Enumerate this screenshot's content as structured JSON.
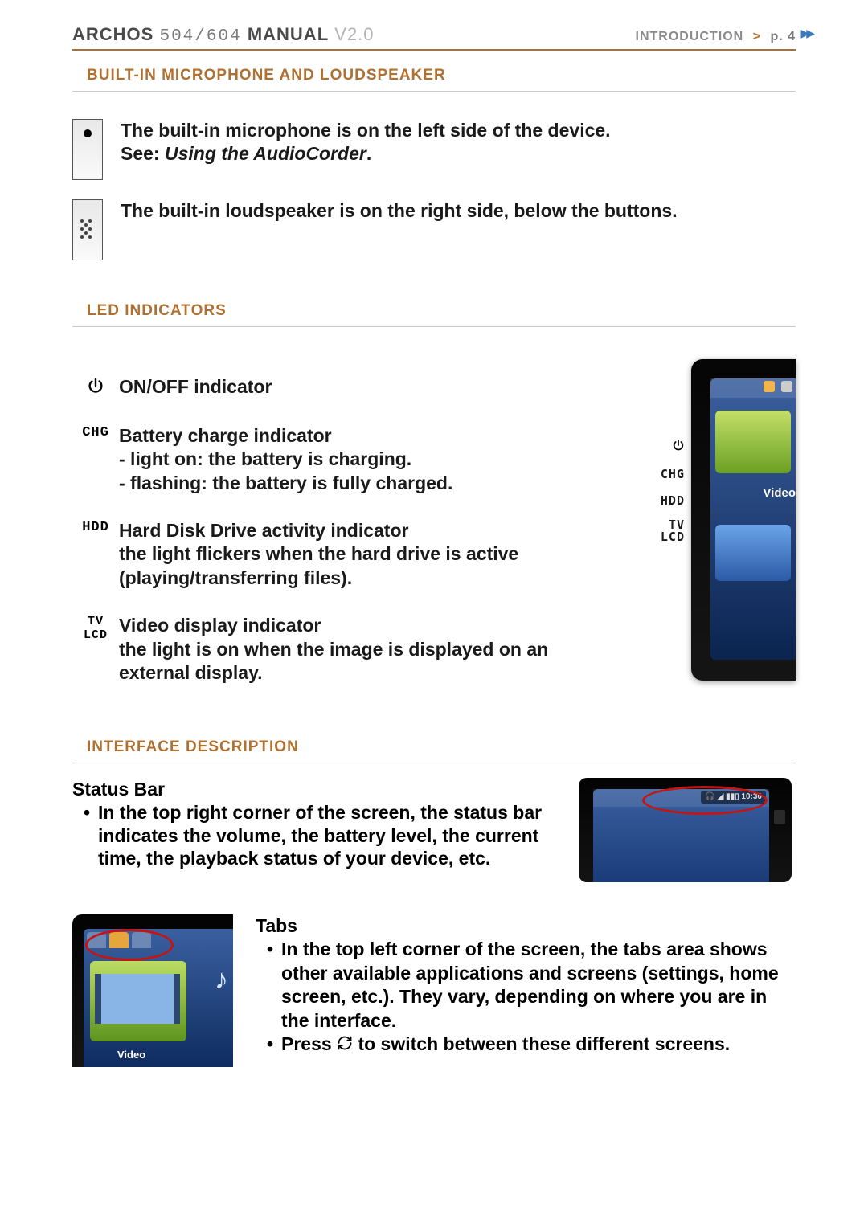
{
  "header": {
    "brand": "ARCHOS",
    "model": "504/604",
    "manual": "MANUAL",
    "version": "V2.0",
    "section": "INTRODUCTION",
    "page_label": "p. 4"
  },
  "sections": {
    "mic_speaker_title": "BUILT-IN MICROPHONE AND LOUDSPEAKER",
    "led_title": "LED INDICATORS",
    "interface_title": "INTERFACE DESCRIPTION"
  },
  "mic": {
    "line1": "The built-in microphone is on the left side of the device.",
    "line2_prefix": "See: ",
    "line2_ref": "Using the AudioCorder",
    "line2_suffix": "."
  },
  "speaker": {
    "line": "The built-in loudspeaker is on the right side, below the buttons."
  },
  "led": {
    "power": {
      "label": "⏻",
      "title": "ON/OFF indicator"
    },
    "chg": {
      "label": "CHG",
      "title": "Battery charge indicator",
      "l1": "- light on: the battery is charging.",
      "l2": "- flashing: the battery is fully charged."
    },
    "hdd": {
      "label": "HDD",
      "title": "Hard Disk Drive activity indicator",
      "desc": "the light flickers when the hard drive is active (playing/transferring files)."
    },
    "tvlcd": {
      "label1": "TV",
      "label2": "LCD",
      "title": "Video display indicator",
      "desc": "the light is on when the image is displayed on an external display."
    }
  },
  "device_side_labels": {
    "chg": "CHG",
    "hdd": "HDD",
    "tv": "TV",
    "lcd": "LCD",
    "screen_tile_label": "Video"
  },
  "statusbar": {
    "heading": "Status Bar",
    "bullet": "In the top right corner of the screen, the status bar indicates the volume, the battery level, the current time, the playback status of your device, etc.",
    "time_shown": "10:30"
  },
  "tabs": {
    "heading": "Tabs",
    "b1": "In the top left corner of the screen, the tabs area shows other available applications and screens (settings, home screen, etc.). They vary, depending on where you are in the interface.",
    "b2a": "Press ",
    "b2b": " to switch between these different screens.",
    "fig_label": "Video"
  }
}
